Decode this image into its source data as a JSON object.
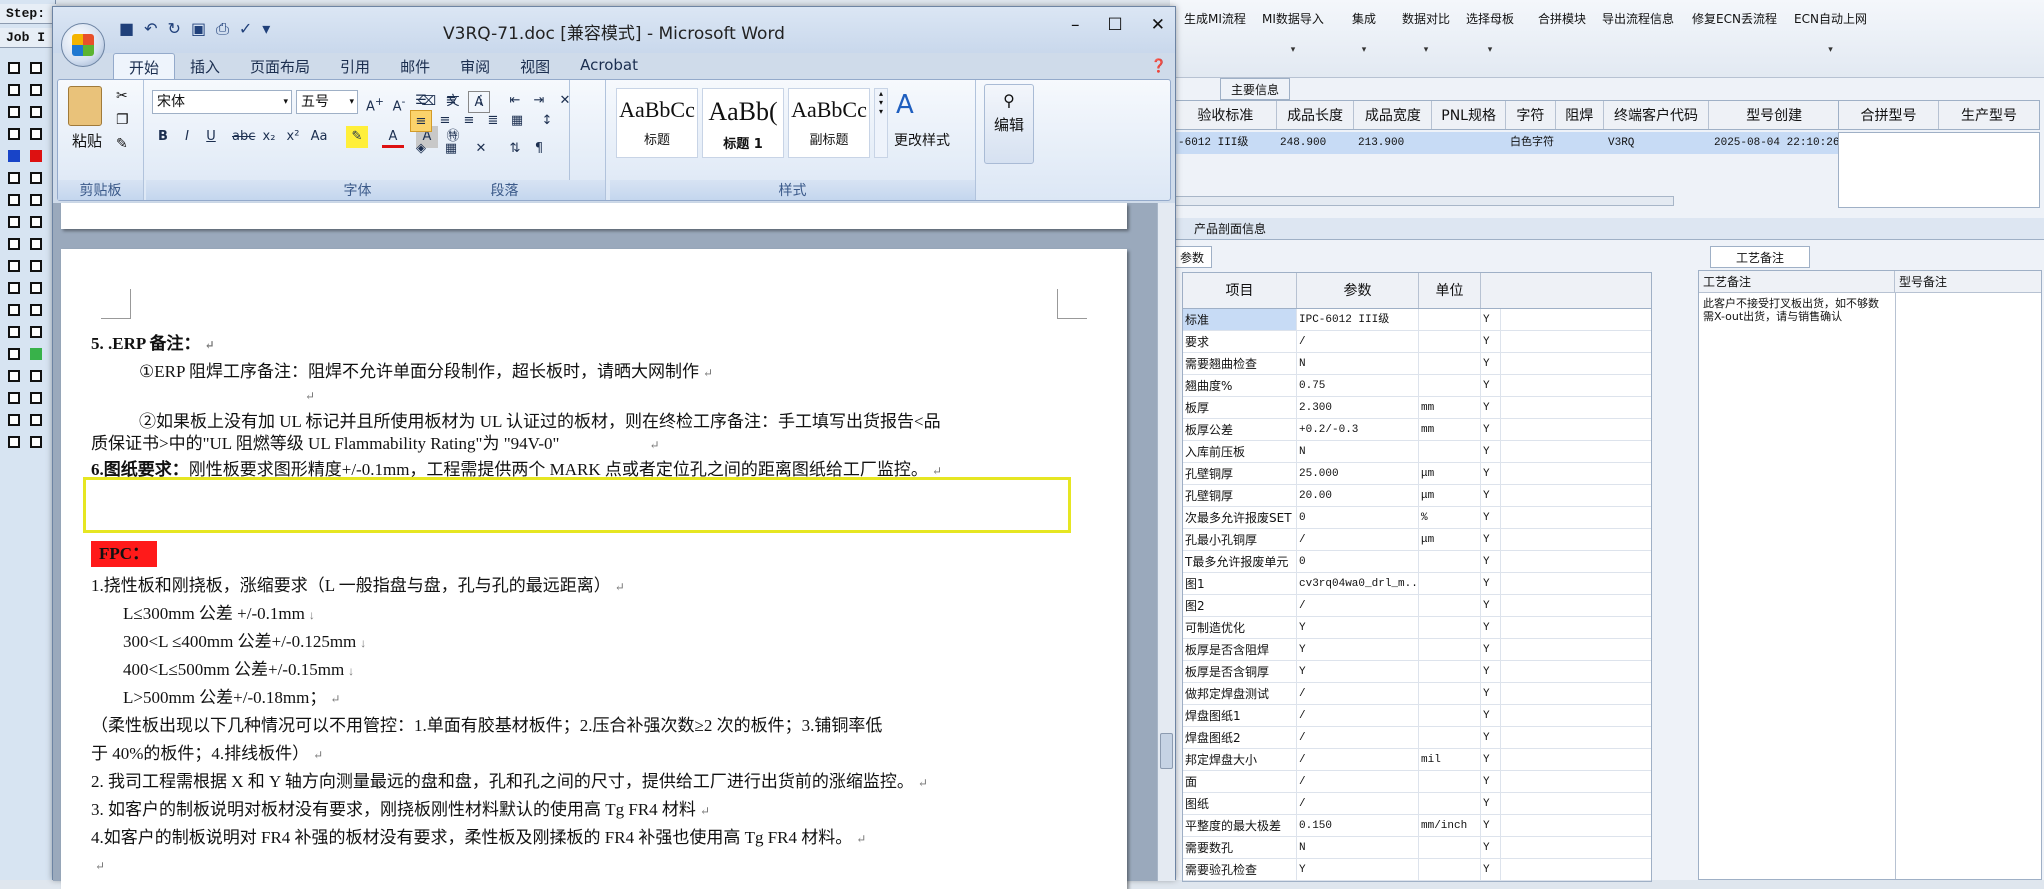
{
  "left_app": {
    "step_label": "Step:",
    "job_label": "Job I"
  },
  "right_app": {
    "toolbar": [
      {
        "label": "生成MI流程",
        "dropdown": false
      },
      {
        "label": "MI数据导入",
        "dropdown": true
      },
      {
        "label": "集成",
        "dropdown": true
      },
      {
        "label": "数据对比",
        "dropdown": true
      },
      {
        "label": "选择母板",
        "dropdown": true
      },
      {
        "label": "合拼模块",
        "dropdown": false
      },
      {
        "label": "导出流程信息",
        "dropdown": false
      },
      {
        "label": "修复ECN丢流程",
        "dropdown": false
      },
      {
        "label": "ECN自动上网",
        "dropdown": true
      }
    ],
    "main_info_tab": "主要信息",
    "main_headers": [
      "验收标准",
      "成品长度",
      "成品宽度",
      "PNL规格",
      "字符",
      "阻焊",
      "终端客户代码",
      "型号创建"
    ],
    "main_row": [
      "-6012 III级",
      "248.900",
      "213.900",
      "",
      "白色字符",
      "",
      "V3RQ",
      "2025-08-04 22:10:26"
    ],
    "merge_headers": [
      "合拼型号",
      "生产型号"
    ],
    "section_title": "产品剖面信息",
    "params_tab": "参数",
    "params_headers": [
      "项目",
      "参数",
      "单位"
    ],
    "params_rows": [
      [
        "标准",
        "IPC-6012 III级",
        "",
        "Y"
      ],
      [
        "要求",
        "/",
        "",
        "Y"
      ],
      [
        "需要翘曲检查",
        "N",
        "",
        "Y"
      ],
      [
        "翘曲度%",
        "0.75",
        "",
        "Y"
      ],
      [
        "板厚",
        "2.300",
        "mm",
        "Y"
      ],
      [
        "板厚公差",
        "+0.2/-0.3",
        "mm",
        "Y"
      ],
      [
        "入库前压板",
        "N",
        "",
        "Y"
      ],
      [
        "孔壁铜厚",
        "25.000",
        "μm",
        "Y"
      ],
      [
        "孔壁铜厚",
        "20.00",
        "μm",
        "Y"
      ],
      [
        "次最多允许报废SET",
        "0",
        "%",
        "Y"
      ],
      [
        "孔最小孔铜厚",
        "/",
        "μm",
        "Y"
      ],
      [
        "T最多允许报废单元",
        "0",
        "",
        "Y"
      ],
      [
        "图1",
        "cv3rq04wa0_drl_m...",
        "",
        "Y"
      ],
      [
        "图2",
        "/",
        "",
        "Y"
      ],
      [
        "可制造优化",
        "Y",
        "",
        "Y"
      ],
      [
        "板厚是否含阻焊",
        "Y",
        "",
        "Y"
      ],
      [
        "板厚是否含铜厚",
        "Y",
        "",
        "Y"
      ],
      [
        "做邦定焊盘测试",
        "/",
        "",
        "Y"
      ],
      [
        "焊盘图纸1",
        "/",
        "",
        "Y"
      ],
      [
        "焊盘图纸2",
        "/",
        "",
        "Y"
      ],
      [
        "邦定焊盘大小",
        "/",
        "mil",
        "Y"
      ],
      [
        "面",
        "/",
        "",
        "Y"
      ],
      [
        "图纸",
        "/",
        "",
        "Y"
      ],
      [
        "平整度的最大极差",
        "0.150",
        "mm/inch",
        "Y"
      ],
      [
        "需要数孔",
        "N",
        "",
        "Y"
      ],
      [
        "需要验孔检查",
        "Y",
        "",
        "Y"
      ]
    ],
    "process_tab": "工艺备注",
    "process_headers": [
      "工艺备注",
      "型号备注"
    ],
    "process_note": "此客户不接受打叉板出货，如不够数需X-out出货，请与销售确认"
  },
  "word": {
    "title": "V3RQ-71.doc [兼容模式] - Microsoft Word",
    "tabs": [
      "开始",
      "插入",
      "页面布局",
      "引用",
      "邮件",
      "审阅",
      "视图",
      "Acrobat"
    ],
    "clipboard": {
      "paste": "粘贴",
      "group": "剪贴板"
    },
    "font": {
      "name": "宋体",
      "size": "五号",
      "group": "字体"
    },
    "paragraph_group": "段落",
    "styles": [
      {
        "sample": "AaBbCc",
        "label": "标题"
      },
      {
        "sample": "AaBb(",
        "label": "标题 1"
      },
      {
        "sample": "AaBbCc",
        "label": "副标题"
      }
    ],
    "styles_group": "样式",
    "change_styles": "更改样式",
    "editing": "编辑"
  },
  "doc": {
    "l1": "5. .ERP 备注：",
    "l2": "①ERP 阻焊工序备注：阻焊不允许单面分段制作，超长板时，请晒大网制作",
    "l3": "②如果板上没有加 UL 标记并且所使用板材为 UL 认证过的板材，则在终检工序备注：手工填写出货报告<品",
    "l4": "质保证书>中的\"UL 阻燃等级 UL Flammability Rating\"为 \"94V-0\"",
    "l5a": "6.图纸要求：",
    "l5b": "刚性板要求图形精度+/-0.1mm，工程需提供两个 MARK 点或者定位孔之间的距离图纸给工厂监控。",
    "fpc": "FPC：",
    "l6": "1.挠性板和刚挠板，涨缩要求（L 一般指盘与盘，孔与孔的最远距离）",
    "l7": "L≤300mm 公差 +/-0.1mm",
    "l8": "300<L ≤400mm 公差+/-0.125mm",
    "l9": "400<L≤500mm 公差+/-0.15mm",
    "l10": "L>500mm 公差+/-0.18mm；",
    "l11": "（柔性板出现以下几种情况可以不用管控：1.单面有胶基材板件；2.压合补强次数≥2 次的板件；3.铺铜率低",
    "l12": "于 40%的板件；4.排线板件）",
    "l13": "2.    我司工程需根据 X 和 Y 轴方向测量最远的盘和盘，孔和孔之间的尺寸，提供给工厂进行出货前的涨缩监控。",
    "l14": "3.  如客户的制板说明对板材没有要求，刚挠板刚性材料默认的使用高 Tg FR4 材料",
    "l15": "4.如客户的制板说明对 FR4 补强的板材没有要求，柔性板及刚揉板的 FR4 补强也使用高 Tg FR4 材料。"
  }
}
